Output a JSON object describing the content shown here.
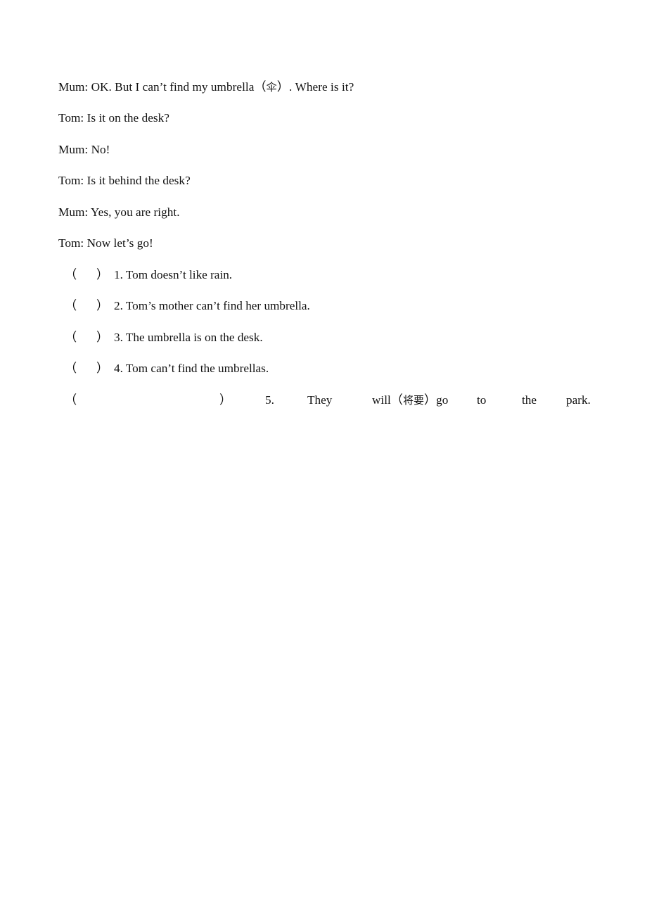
{
  "document": {
    "type": "english-worksheet-page",
    "background_color": "#ffffff",
    "text_color": "#111111"
  },
  "dialogue": {
    "lines": [
      {
        "speaker": "Mum",
        "text": "Mum: OK. But I can’t find my umbrella（伞）. Where is it?"
      },
      {
        "speaker": "Tom",
        "text": "Tom: Is it on the desk?"
      },
      {
        "speaker": "Mum",
        "text": "Mum: No!"
      },
      {
        "speaker": "Tom",
        "text": "Tom: Is it behind the desk?"
      },
      {
        "speaker": "Mum",
        "text": "Mum: Yes, you are right."
      },
      {
        "speaker": "Tom",
        "text": "Tom: Now let’s go!"
      }
    ],
    "line_1_parts": {
      "before": "Mum: OK. But I can’t find my umbrella（",
      "cjk": "伞",
      "after": "）. Where is it?"
    }
  },
  "statements": {
    "paren_open": "（",
    "paren_close": "）",
    "items": [
      {
        "number": "1.",
        "text": "1. Tom doesn’t like rain."
      },
      {
        "number": "2.",
        "text": "2. Tom’s mother can’t find her umbrella."
      },
      {
        "number": "3.",
        "text": "3. The umbrella is on the desk."
      },
      {
        "number": "4.",
        "text": "4. Tom can’t find the umbrellas."
      }
    ],
    "last_item": {
      "number": "5.",
      "full_text": "5. They will（将要）go to the park.",
      "words": {
        "number": "5.",
        "they": "They",
        "will_before": "will（",
        "will_cjk": "将要",
        "will_after": "）go",
        "to": "to",
        "the": "the",
        "park": "park."
      }
    }
  }
}
